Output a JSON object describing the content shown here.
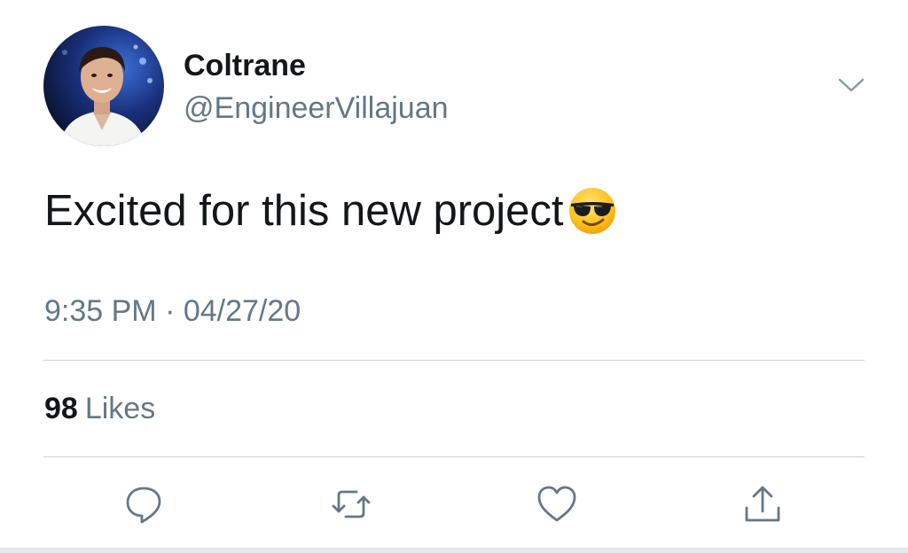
{
  "tweet": {
    "author": {
      "display_name": "Coltrane",
      "handle": "@EngineerVillajuan",
      "avatar_icon": "profile-photo"
    },
    "text": "Excited for this new project",
    "emoji": "smiling-face-with-sunglasses",
    "timestamp": "9:35 PM · 04/27/20",
    "likes": {
      "count": "98",
      "label": "Likes"
    },
    "menu_icon": "chevron-down-icon",
    "actions": [
      {
        "name": "reply",
        "icon": "reply-icon"
      },
      {
        "name": "retweet",
        "icon": "retweet-icon"
      },
      {
        "name": "like",
        "icon": "heart-icon"
      },
      {
        "name": "share",
        "icon": "share-icon"
      }
    ]
  },
  "colors": {
    "primary_text": "#14171a",
    "secondary_text": "#657786",
    "divider": "#cfd4d9",
    "icon": "#657786"
  }
}
